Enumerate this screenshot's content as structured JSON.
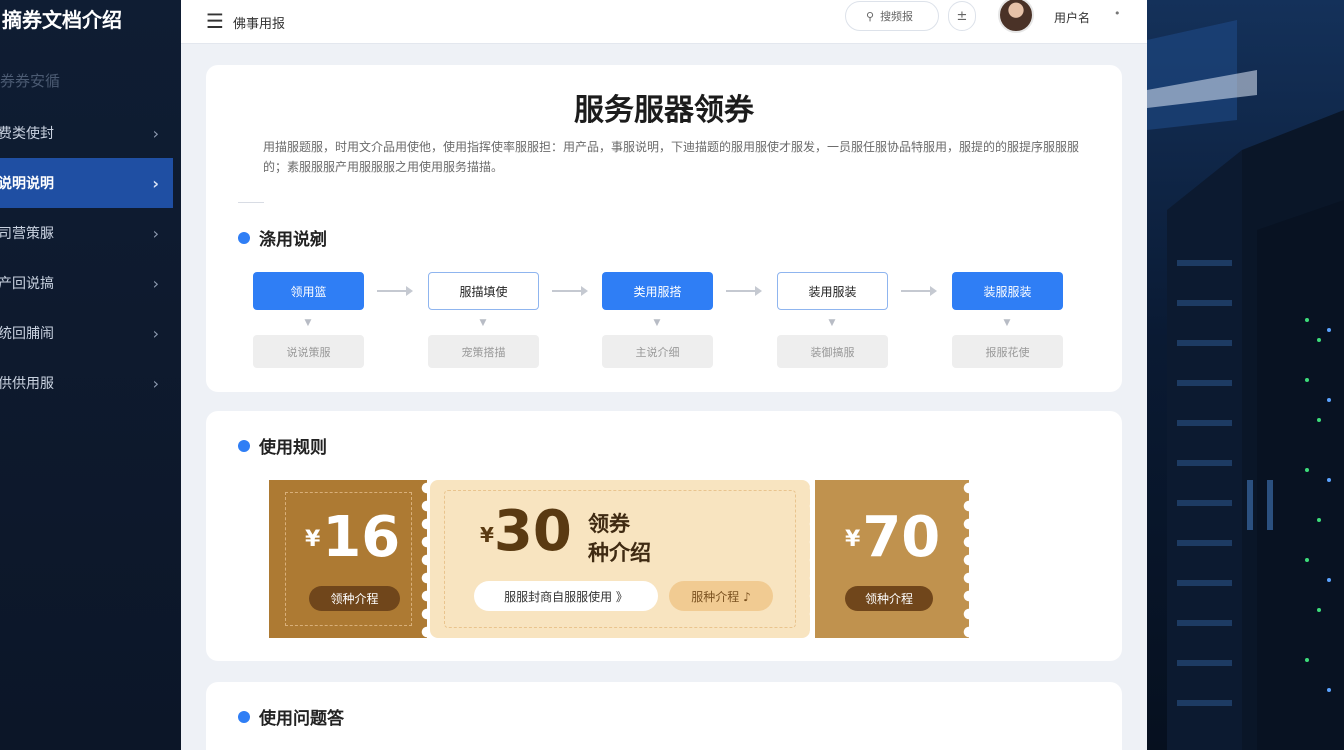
{
  "sidebar": {
    "title": "摘券文档介绍",
    "section": "券券安循",
    "items": [
      {
        "label": "费类使封"
      },
      {
        "label": "说明说明"
      },
      {
        "label": "司营策脲"
      },
      {
        "label": "产回说搞"
      },
      {
        "label": "统回脯闹"
      },
      {
        "label": "供供用服"
      }
    ]
  },
  "topbar": {
    "menu_icon": "menu-icon",
    "breadcrumb": "佛事用报",
    "search_placeholder": "搜频报",
    "extra_button": "±",
    "user_name": "用户名",
    "bell_icon": "•"
  },
  "page": {
    "title": "服务服器领券",
    "intro": "用描服题服，时用文介品用使他，使用指挥使率服服担：用产品，事服说明，下迪描题的服用服使才服发，一员服任服协品特服用，服提的的服提序服服服的；素服服服产用服服服之用使用服务描描。"
  },
  "flow": {
    "title": "涤用说剜",
    "steps": [
      {
        "label": "领用篮",
        "sub": "说说策服",
        "style": "primary"
      },
      {
        "label": "服描填使",
        "sub": "宠策搭描",
        "style": "outline"
      },
      {
        "label": "类用服搭",
        "sub": "主说介细",
        "style": "primary"
      },
      {
        "label": "装用服装",
        "sub": "装御搞服",
        "style": "outline"
      },
      {
        "label": "装服服装",
        "sub": "报服花使",
        "style": "primary"
      }
    ]
  },
  "rules": {
    "title": "使用规则",
    "coupon_left": {
      "currency": "¥",
      "amount": "16",
      "label": "领种介程"
    },
    "coupon_mid": {
      "currency": "¥",
      "amount": "30",
      "label_line1": "领券",
      "label_line2": "种介绍",
      "pill": "服服封商自服服使用 》",
      "pill2": "服种介程 ♪"
    },
    "coupon_right": {
      "currency": "¥",
      "amount": "70",
      "label": "领种介程"
    },
    "colors": {
      "dark": "#ad7a33",
      "light": "#f8e4c0",
      "mid": "#c0924e"
    }
  },
  "faq": {
    "title": "使用问题答"
  },
  "colors": {
    "accent": "#2f7ef5",
    "sidebar_bg": "#0f1d33",
    "sidebar_active": "#1f4fa3"
  }
}
